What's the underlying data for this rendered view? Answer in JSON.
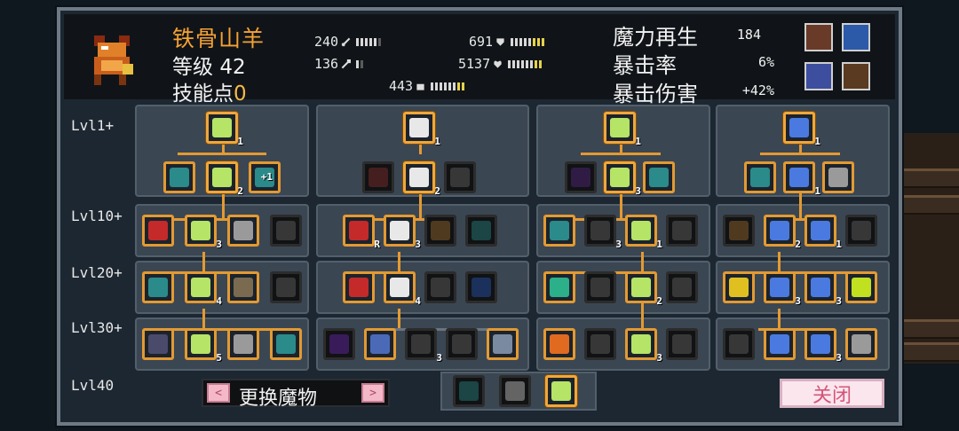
{
  "monster": {
    "name": "铁骨山羊",
    "level_label": "等级",
    "level": "42",
    "skill_points_label": "技能点",
    "skill_points": "0"
  },
  "stats": {
    "attack": {
      "value": "240",
      "icon": "sword-icon"
    },
    "armor": {
      "value": "691",
      "icon": "shield-icon"
    },
    "magic_attack": {
      "value": "136",
      "icon": "wand-icon"
    },
    "health": {
      "value": "5137",
      "icon": "heart-icon"
    },
    "speed": {
      "value": "443",
      "icon": "boot-icon"
    }
  },
  "ratings": [
    {
      "label": "魔力再生",
      "value": "184"
    },
    {
      "label": "暴击率",
      "value": "6%"
    },
    {
      "label": "暴击伤害",
      "value": "+42%"
    }
  ],
  "level_labels": [
    "Lvl1+",
    "Lvl10+",
    "Lvl20+",
    "Lvl30+",
    "Lvl40"
  ],
  "skill_badges": {
    "b1": "1",
    "b2": "1",
    "b3": "1",
    "b4": "1",
    "a1": "2",
    "a2": "+1",
    "a3": "2",
    "a4": "3",
    "a5": "1",
    "c1": "3",
    "c2": "R",
    "c3": "3",
    "c4": "3",
    "c5": "1",
    "c6": "2",
    "c7": "1",
    "d1": "4",
    "d2": "4",
    "d3": "2",
    "d4": "3",
    "d5": "3",
    "e1": "5",
    "e2": "3",
    "e3": "3",
    "e4": "3"
  },
  "buttons": {
    "prev": "<",
    "next": ">",
    "change_monster": "更换魔物",
    "close": "关闭"
  },
  "colors": {
    "accent": "#e39a32",
    "name": "#f6a233",
    "panel": "#3b4653"
  }
}
